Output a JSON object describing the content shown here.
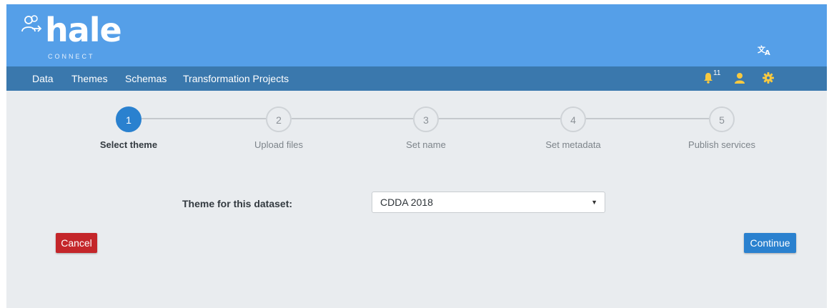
{
  "header": {
    "logo_text": "hale",
    "logo_subtext": "CONNECT",
    "language_icon": "translate-icon"
  },
  "nav": {
    "items": [
      "Data",
      "Themes",
      "Schemas",
      "Transformation Projects"
    ],
    "notification_count": "11",
    "icons": [
      "bell-icon",
      "user-icon",
      "gear-icon"
    ]
  },
  "stepper": {
    "steps": [
      {
        "number": "1",
        "label": "Select theme",
        "active": true
      },
      {
        "number": "2",
        "label": "Upload files",
        "active": false
      },
      {
        "number": "3",
        "label": "Set name",
        "active": false
      },
      {
        "number": "4",
        "label": "Set metadata",
        "active": false
      },
      {
        "number": "5",
        "label": "Publish services",
        "active": false
      }
    ]
  },
  "form": {
    "theme_label": "Theme for this dataset:",
    "theme_value": "CDDA 2018"
  },
  "buttons": {
    "cancel": "Cancel",
    "continue": "Continue"
  },
  "colors": {
    "header": "#559fe8",
    "navbar": "#3a78ad",
    "accent": "#2a81cf",
    "danger": "#c4262a"
  }
}
